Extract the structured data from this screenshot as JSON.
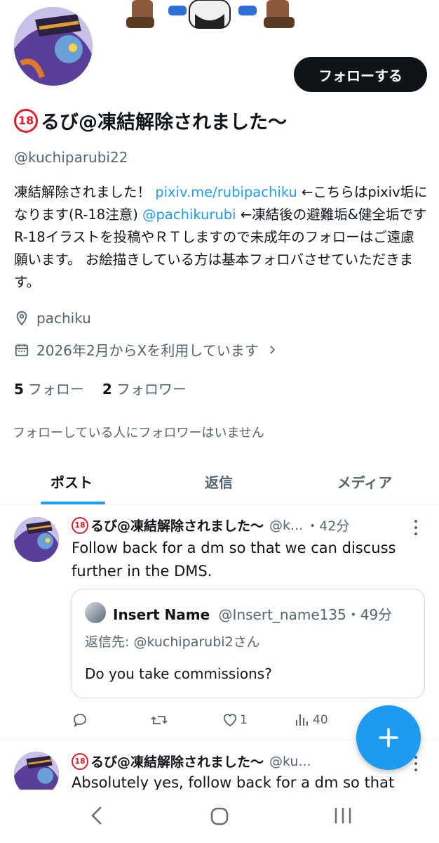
{
  "profile": {
    "name_badge": "18",
    "name": "るび@凍結解除されました〜",
    "handle": "@kuchiparubi22",
    "follow_button": "フォローする",
    "bio": {
      "part1": "凍結解除されました！ ",
      "link1": "pixiv.me/rubipachiku",
      "part2": " ←こちらはpixiv垢になります(R-18注意) ",
      "link2": "@pachikurubi",
      "part3": " ←凍結後の避難垢&健全垢です R-18イラストを投稿やＲＴしますので未成年のフォローはご遠慮願います。 お絵描きしている方は基本フォロバさせていただきます。"
    },
    "location": "pachiku",
    "joined": "2026年2月からXを利用しています",
    "following_count": "5",
    "following_label": "フォロー",
    "followers_count": "2",
    "followers_label": "フォロワー",
    "followers_you_know": "フォローしている人にフォロワーはいません"
  },
  "tabs": [
    {
      "label": "ポスト",
      "active": true
    },
    {
      "label": "返信",
      "active": false
    },
    {
      "label": "メディア",
      "active": false
    }
  ],
  "posts": [
    {
      "name": "るび@凍結解除されました〜",
      "handle": "@k...",
      "time": "・42分",
      "text": "Follow back for a dm so that we can discuss further in the DMS.",
      "quote": {
        "name": "Insert Name",
        "handle": "@Insert_name135",
        "time": "・49分",
        "reply_to": "返信先: @kuchiparubi2さん",
        "text": "Do you take commissions?"
      },
      "likes": "1",
      "views": "40"
    },
    {
      "name": "るび@凍結解除されました〜",
      "handle": "@ku...",
      "time": "",
      "text": "Absolutely yes, follow back for a dm so that"
    }
  ],
  "colors": {
    "accent": "#1d9bf0",
    "text": "#0f1419",
    "muted": "#536471",
    "r18": "#e0202a"
  },
  "icons": [
    "location-icon",
    "calendar-icon",
    "chevron-right-icon",
    "reply-icon",
    "retweet-icon",
    "like-icon",
    "views-icon",
    "compose-plus-icon",
    "nav-back-icon",
    "nav-home-icon",
    "nav-recents-icon",
    "more-icon"
  ]
}
